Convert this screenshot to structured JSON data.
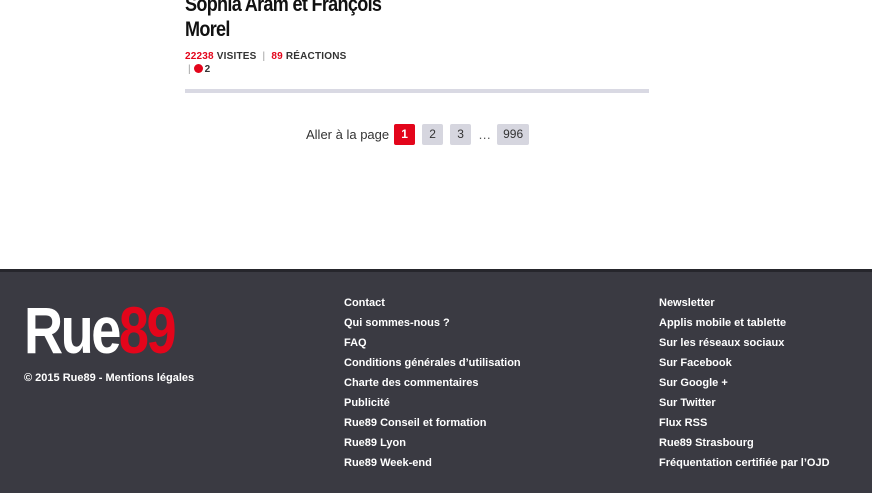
{
  "article": {
    "title_line1": "Sophia Aram et François",
    "title_line2": "Morel",
    "visits_count": "22238",
    "visits_label": "VISITES",
    "reactions_count": "89",
    "reactions_label": "RÉACTIONS",
    "live_count": "2"
  },
  "pager": {
    "label": "Aller à la page",
    "pages": [
      "1",
      "2",
      "3"
    ],
    "ellipsis": "…",
    "last": "996"
  },
  "footer": {
    "logo_part1": "Rue",
    "logo_part2": "89",
    "copyright": "© 2015 Rue89 - Mentions légales",
    "col1": [
      "Contact",
      "Qui sommes-nous ?",
      "FAQ",
      "Conditions générales d’utilisation",
      "Charte des commentaires",
      "Publicité",
      "Rue89 Conseil et formation",
      "Rue89 Lyon",
      "Rue89 Week-end"
    ],
    "col2": [
      "Newsletter",
      "Applis mobile et tablette",
      "Sur les réseaux sociaux",
      "Sur Facebook",
      "Sur Google +",
      "Sur Twitter",
      "Flux RSS",
      "Rue89 Strasbourg",
      "Fréquentation certifiée par l’OJD"
    ]
  },
  "colors": {
    "accent": "#e3051b",
    "footer_bg": "#3a3a42"
  }
}
